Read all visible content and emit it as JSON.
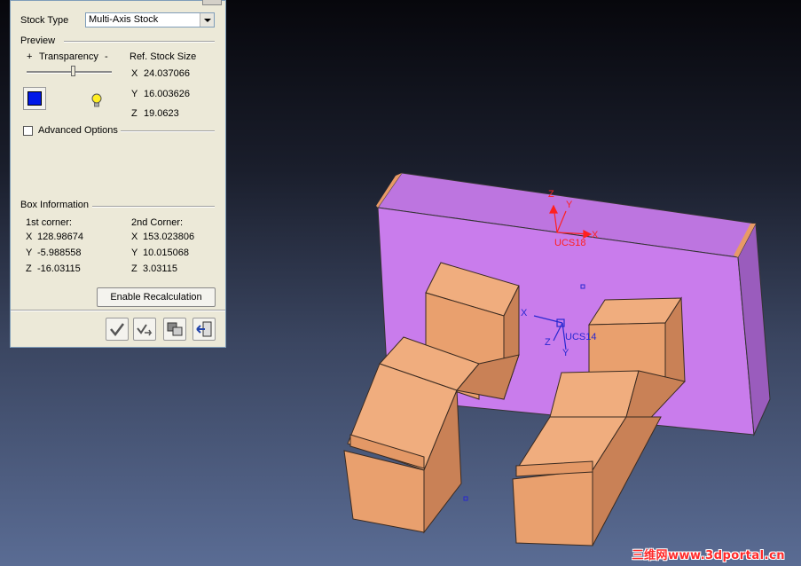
{
  "dialog": {
    "stock_type_label": "Stock Type",
    "stock_type_value": "Multi-Axis Stock",
    "preview_label": "Preview",
    "transparency_plus": "+",
    "transparency_label": "Transparency",
    "transparency_minus": "-",
    "transparency_level": 0.55,
    "ref_stock_size_label": "Ref. Stock Size",
    "ref_size": {
      "x_label": "X",
      "x": "24.037066",
      "y_label": "Y",
      "y": "16.003626",
      "z_label": "Z",
      "z": "19.0623"
    },
    "preview_color": "#0018e8",
    "advanced_options_label": "Advanced Options",
    "advanced_options_checked": false,
    "box_info_label": "Box Information",
    "first_corner": {
      "label": "1st corner:",
      "x_label": "X",
      "x": "128.98674",
      "y_label": "Y",
      "y": "-5.988558",
      "z_label": "Z",
      "z": "-16.03115"
    },
    "second_corner": {
      "label": "2nd Corner:",
      "x_label": "X",
      "x": "153.023806",
      "y_label": "Y",
      "y": "10.015068",
      "z_label": "Z",
      "z": "3.03115"
    },
    "enable_recalc_label": "Enable Recalculation",
    "footer_icons": [
      "ok-check-icon",
      "apply-icon",
      "preview-icon",
      "cancel-exit-icon"
    ]
  },
  "viewport": {
    "ucs_top": {
      "label": "UCS18",
      "x": "X",
      "y": "Y",
      "z": "Z",
      "color": "#ff2020"
    },
    "ucs_mid": {
      "label": "UCS14",
      "x": "X",
      "y": "Y",
      "z": "Z",
      "color": "#2828d0"
    },
    "stock_color": "#c77ae8",
    "part_color": "#e89a66"
  },
  "watermark": "三维网www.3dportal.cn"
}
